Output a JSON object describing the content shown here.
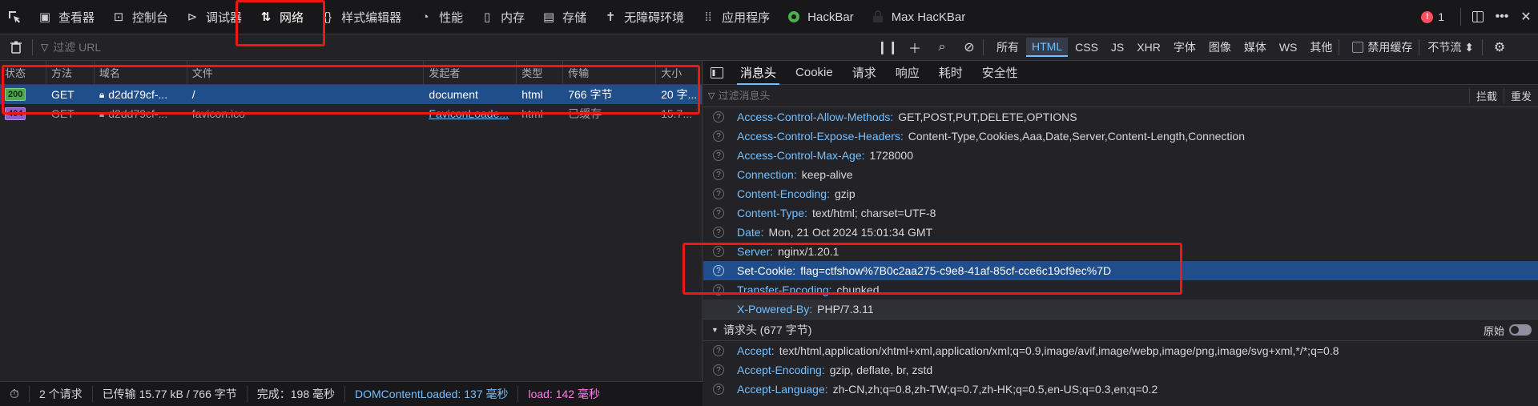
{
  "toolbar": {
    "tabs": [
      {
        "label": "查看器",
        "icon": "inspector-icon"
      },
      {
        "label": "控制台",
        "icon": "console-icon"
      },
      {
        "label": "调试器",
        "icon": "debugger-icon"
      },
      {
        "label": "网络",
        "icon": "network-icon"
      },
      {
        "label": "样式编辑器",
        "icon": "style-editor-icon"
      },
      {
        "label": "性能",
        "icon": "performance-icon"
      },
      {
        "label": "内存",
        "icon": "memory-icon"
      },
      {
        "label": "存储",
        "icon": "storage-icon"
      },
      {
        "label": "无障碍环境",
        "icon": "accessibility-icon"
      },
      {
        "label": "应用程序",
        "icon": "application-icon"
      },
      {
        "label": "HackBar",
        "icon": "hackbar-icon"
      },
      {
        "label": "Max HacKBar",
        "icon": "max-hackbar-icon"
      }
    ],
    "active_tab": "网络",
    "error_count": "1"
  },
  "filterbar": {
    "placeholder": "过滤 URL",
    "types": [
      "所有",
      "HTML",
      "CSS",
      "JS",
      "XHR",
      "字体",
      "图像",
      "媒体",
      "WS",
      "其他"
    ],
    "selected_type": "HTML",
    "disable_cache": "禁用缓存",
    "throttle": "不节流 ⬍"
  },
  "requests": {
    "columns": [
      "状态",
      "方法",
      "域名",
      "文件",
      "发起者",
      "类型",
      "传输",
      "大小"
    ],
    "rows": [
      {
        "status": "200",
        "method": "GET",
        "domain": "d2dd79cf-...",
        "file": "/",
        "initiator": "document",
        "type": "html",
        "transferred": "766 字节",
        "size": "20 字..."
      },
      {
        "status": "404",
        "method": "GET",
        "domain": "d2dd79cf-...",
        "file": "favicon.ico",
        "initiator": "FaviconLoade...",
        "type": "html",
        "transferred": "已缓存",
        "size": "15.7..."
      }
    ]
  },
  "statusbar": {
    "requests": "2 个请求",
    "transferred": "已传输 15.77 kB / 766 字节",
    "finish": "完成：198 毫秒",
    "dcl": "DOMContentLoaded: 137 毫秒",
    "load": "load: 142 毫秒"
  },
  "details": {
    "tabs": [
      "消息头",
      "Cookie",
      "请求",
      "响应",
      "耗时",
      "安全性"
    ],
    "active_tab": "消息头",
    "filter_placeholder": "过滤消息头",
    "block": "拦截",
    "resend": "重发",
    "response_headers": [
      {
        "k": "Access-Control-Allow-Methods:",
        "v": "GET,POST,PUT,DELETE,OPTIONS"
      },
      {
        "k": "Access-Control-Expose-Headers:",
        "v": "Content-Type,Cookies,Aaa,Date,Server,Content-Length,Connection"
      },
      {
        "k": "Access-Control-Max-Age:",
        "v": "1728000"
      },
      {
        "k": "Connection:",
        "v": "keep-alive"
      },
      {
        "k": "Content-Encoding:",
        "v": "gzip"
      },
      {
        "k": "Content-Type:",
        "v": "text/html; charset=UTF-8"
      },
      {
        "k": "Date:",
        "v": "Mon, 21 Oct 2024 15:01:34 GMT"
      },
      {
        "k": "Server:",
        "v": "nginx/1.20.1"
      },
      {
        "k": "Set-Cookie:",
        "v": "flag=ctfshow%7B0c2aa275-c9e8-41af-85cf-cce6c19cf9ec%7D"
      },
      {
        "k": "Transfer-Encoding:",
        "v": "chunked"
      },
      {
        "k": "X-Powered-By:",
        "v": "PHP/7.3.11"
      }
    ],
    "request_section": "请求头 (677 字节)",
    "raw_label": "原始",
    "request_headers": [
      {
        "k": "Accept:",
        "v": "text/html,application/xhtml+xml,application/xml;q=0.9,image/avif,image/webp,image/png,image/svg+xml,*/*;q=0.8"
      },
      {
        "k": "Accept-Encoding:",
        "v": "gzip, deflate, br, zstd"
      },
      {
        "k": "Accept-Language:",
        "v": "zh-CN,zh;q=0.8,zh-TW;q=0.7,zh-HK;q=0.5,en-US;q=0.3,en;q=0.2"
      }
    ]
  },
  "colors": {
    "accent": "#75bfff",
    "selection": "#204e8a",
    "annotation": "#f01616"
  }
}
